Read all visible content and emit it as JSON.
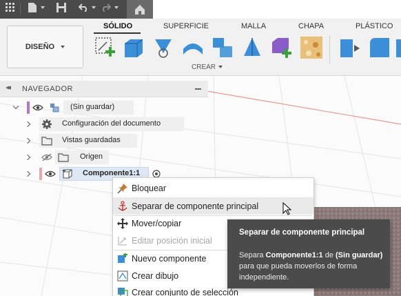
{
  "toolbar": {
    "workspace_label": "DISEÑO",
    "tabs": [
      "SÓLIDO",
      "SUPERFICIE",
      "MALLA",
      "CHAPA",
      "PLÁSTICO"
    ],
    "group_label": "CREAR"
  },
  "navigator": {
    "title": "NAVEGADOR",
    "root_label": "(Sin guardar)",
    "items": [
      {
        "label": "Configuración del documento"
      },
      {
        "label": "Vistas guardadas"
      },
      {
        "label": "Origen"
      },
      {
        "label": "Componente1:1"
      }
    ]
  },
  "context_menu": {
    "items": [
      {
        "label": "Bloquear",
        "icon": "pin-icon",
        "enabled": true
      },
      {
        "label": "Separar de componente principal",
        "icon": "anchor-icon",
        "enabled": true
      },
      {
        "label": "Mover/copiar",
        "icon": "move-icon",
        "enabled": true
      },
      {
        "label": "Editar posición inicial",
        "icon": "edit-position-icon",
        "enabled": false
      },
      {
        "label": "Nuevo componente",
        "icon": "new-component-icon",
        "enabled": true
      },
      {
        "label": "Crear dibujo",
        "icon": "drawing-icon",
        "enabled": true
      },
      {
        "label": "Crear conjunto de selección",
        "icon": "selection-set-icon",
        "enabled": true
      }
    ]
  },
  "tooltip": {
    "title": "Separar de componente principal",
    "text_prefix": "Separa ",
    "text_component": "Componente1:1",
    "text_mid": " de ",
    "text_parent": "(Sin guardar)",
    "text_suffix": " para que pueda moverlos de forma independiente."
  },
  "colors": {
    "accent_root": "#b07ac2",
    "accent_component": "#e9a4ae",
    "toolbar_blue": "#3a8fd8",
    "tooltip_bg": "#4b4b4b"
  }
}
